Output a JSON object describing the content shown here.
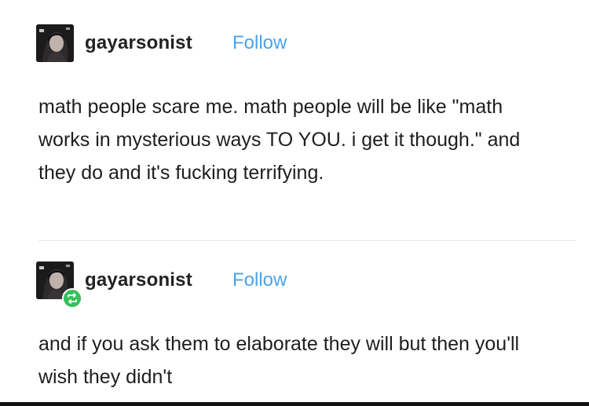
{
  "posts": [
    {
      "username": "gayarsonist",
      "follow_label": "Follow",
      "is_reblog": false,
      "body": "math people scare me. math people will be like \"math works in mysterious ways TO YOU. i get it though.\" and they do and it's fucking terrifying."
    },
    {
      "username": "gayarsonist",
      "follow_label": "Follow",
      "is_reblog": true,
      "body": "and if you ask them to elaborate they will but then you'll wish they didn't"
    }
  ],
  "colors": {
    "follow": "#4aa3e8",
    "reblog_badge": "#35c05a",
    "text": "#1e1e1e"
  }
}
